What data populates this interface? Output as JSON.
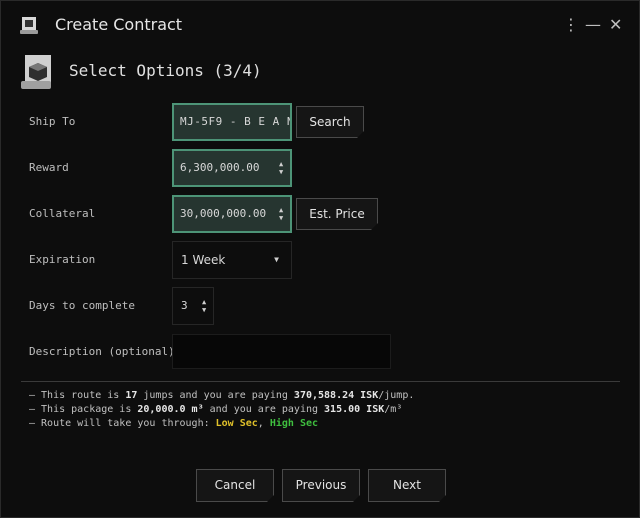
{
  "window": {
    "title": "Create Contract"
  },
  "header": {
    "title": "Select Options (3/4)"
  },
  "fields": {
    "ship_to": {
      "label": "Ship To",
      "value": "MJ-5F9 - B E A N",
      "button": "Search"
    },
    "reward": {
      "label": "Reward",
      "value": "6,300,000.00"
    },
    "collateral": {
      "label": "Collateral",
      "value": "30,000,000.00",
      "button": "Est. Price"
    },
    "expiration": {
      "label": "Expiration",
      "value": "1 Week"
    },
    "days": {
      "label": "Days to complete",
      "value": "3"
    },
    "description": {
      "label": "Description (optional)",
      "value": ""
    }
  },
  "info": {
    "line1": {
      "prefix": "– This route is ",
      "jumps": "17",
      "mid": " jumps and you are paying ",
      "isk": "370,588.24",
      "unit": " ISK",
      "suffix": "/jump."
    },
    "line2": {
      "prefix": "– This package is ",
      "volume": "20,000.0 m³",
      "mid": " and you are paying ",
      "isk": "315.00",
      "unit": " ISK",
      "suffix": "/m³"
    },
    "line3": {
      "prefix": "– Route will take you through: ",
      "low": "Low Sec",
      "sep": ", ",
      "high": "High Sec"
    }
  },
  "buttons": {
    "cancel": "Cancel",
    "previous": "Previous",
    "next": "Next"
  },
  "icons": {
    "window": "contract-scroll-icon",
    "section": "contract-scroll-icon"
  },
  "colors": {
    "accent": "#4d9477",
    "low_sec": "#e0c12a",
    "high_sec": "#3fbf3f"
  }
}
